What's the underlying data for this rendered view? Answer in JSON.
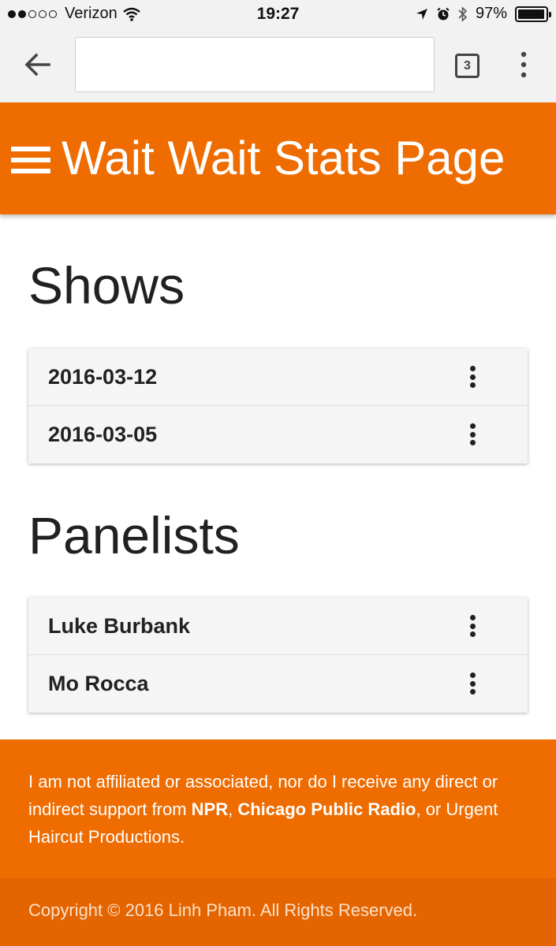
{
  "status_bar": {
    "carrier": "Verizon",
    "time": "19:27",
    "battery": "97%",
    "battery_level": 0.97
  },
  "browser": {
    "url_value": "",
    "tab_count": "3"
  },
  "header": {
    "title": "Wait Wait Stats Page"
  },
  "shows": {
    "title": "Shows",
    "items": [
      "2016-03-12",
      "2016-03-05"
    ]
  },
  "panelists": {
    "title": "Panelists",
    "items": [
      "Luke Burbank",
      "Mo Rocca"
    ]
  },
  "footer": {
    "text_1": "I am not affiliated or associated, nor do I receive any direct or indirect support from ",
    "npr": "NPR",
    "sep": ", ",
    "cpr": "Chicago Public Radio",
    "text_2": ", or Urgent Haircut Productions.",
    "copyright": "Copyright © 2016 Linh Pham. All Rights Reserved."
  },
  "colors": {
    "accent": "#ef6c00",
    "accent_dark": "#e46500",
    "card_bg": "#f5f5f5"
  }
}
